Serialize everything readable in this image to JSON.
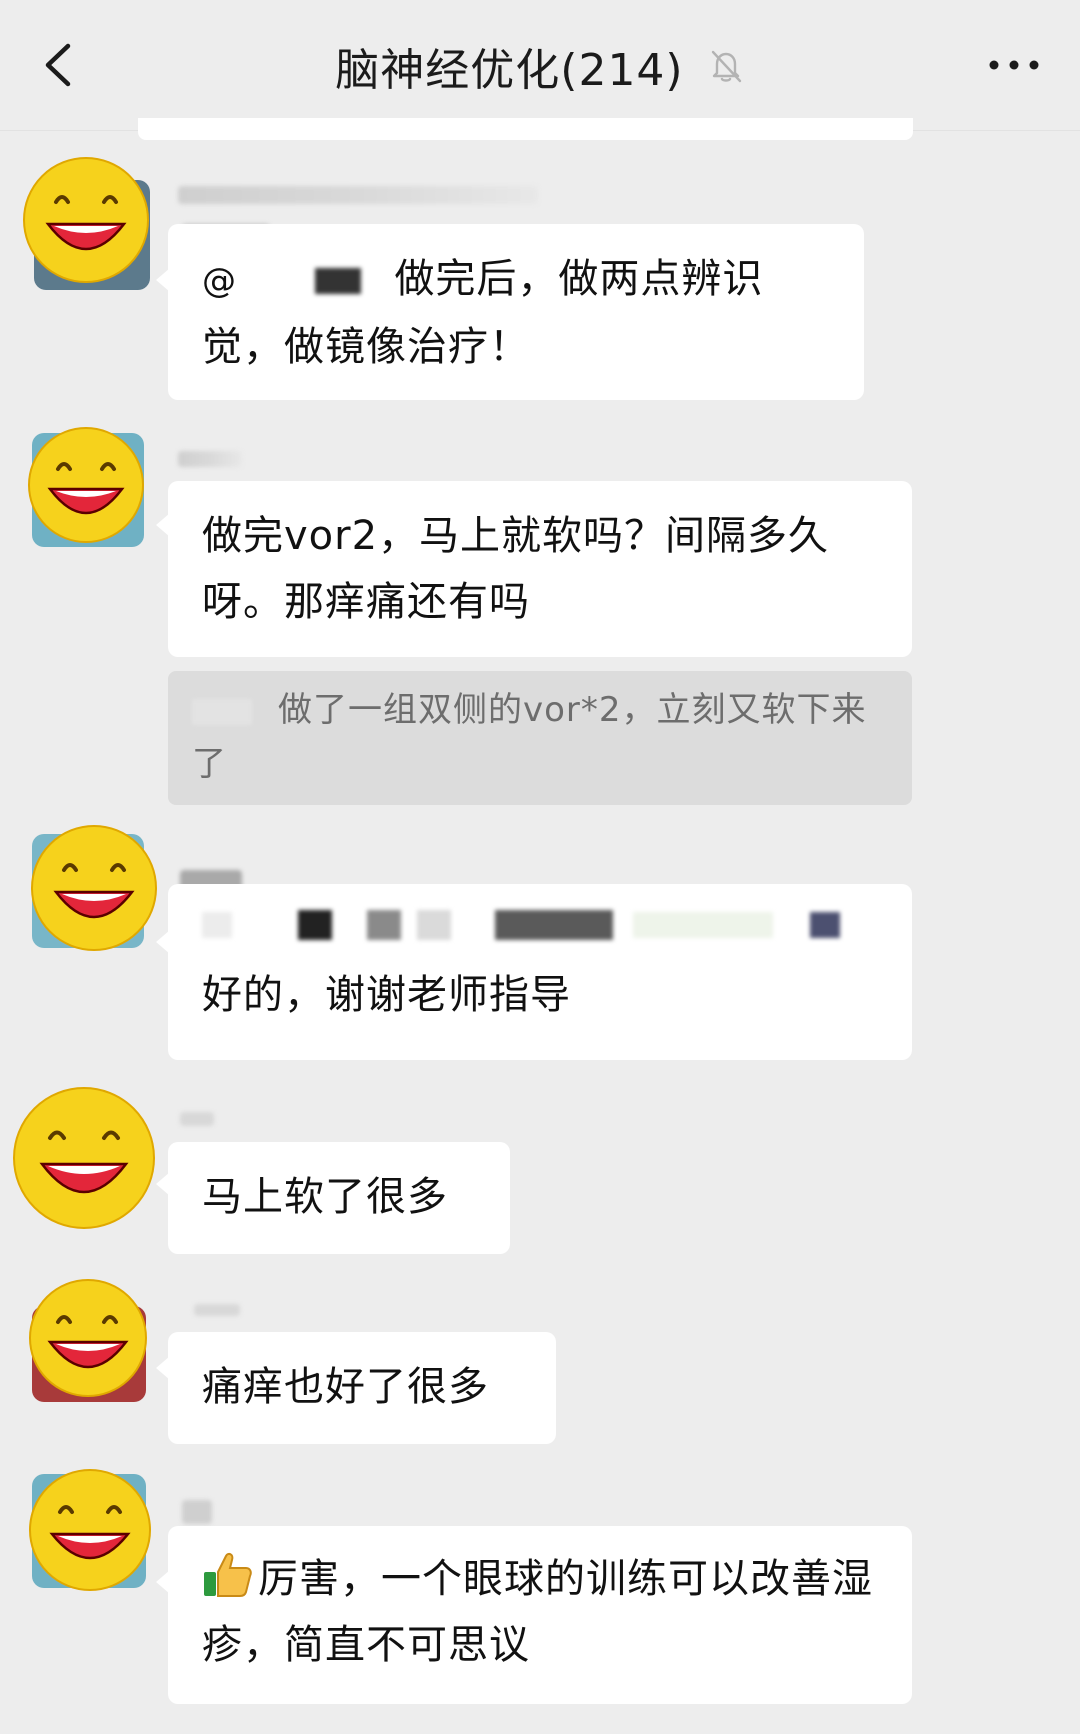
{
  "header": {
    "title": "脑神经优化(214)",
    "back_icon": "chevron-left-icon",
    "mute_icon": "bell-off-icon",
    "more_icon": "more-horizontal-icon"
  },
  "messages": [
    {
      "text_prefix": "@",
      "text_main": "做完后，做两点辨识觉，做镜像治疗！"
    },
    {
      "text": "做完vor2，马上就软吗？间隔多久呀。那痒痛还有吗"
    },
    {
      "quote_text": "做了一组双侧的vor*2，立刻又软下来了"
    },
    {
      "text": "好的，谢谢老师指导"
    },
    {
      "text": "马上软了很多"
    },
    {
      "text": "痛痒也好了很多"
    },
    {
      "emoji": "thumbs-up-icon",
      "text": "厉害，一个眼球的训练可以改善湿疹，简直不可思议"
    }
  ],
  "colors": {
    "background": "#ededed",
    "bubble": "#ffffff",
    "quote_bg": "#dcdcdc",
    "text": "#111111",
    "muted_text": "#6d6d6d",
    "smiley_yellow": "#f6d21c",
    "smiley_mouth": "#e3263a"
  }
}
